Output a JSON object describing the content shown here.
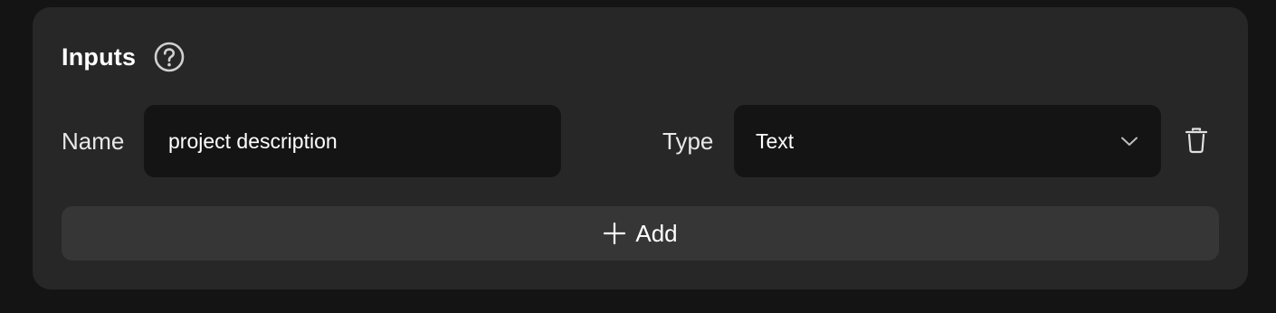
{
  "inputs_section": {
    "title": "Inputs",
    "help_icon": "question-circle-icon"
  },
  "row": {
    "name_label": "Name",
    "name_value": "project description",
    "type_label": "Type",
    "type_value": "Text",
    "dropdown_icon": "chevron-down-icon",
    "delete_icon": "trash-icon"
  },
  "add_button": {
    "label": "Add",
    "icon": "plus-icon"
  },
  "colors": {
    "page_background": "#141414",
    "panel_background": "#272727",
    "field_background": "#141414",
    "add_button_background": "#363636",
    "text": "#ffffff"
  }
}
